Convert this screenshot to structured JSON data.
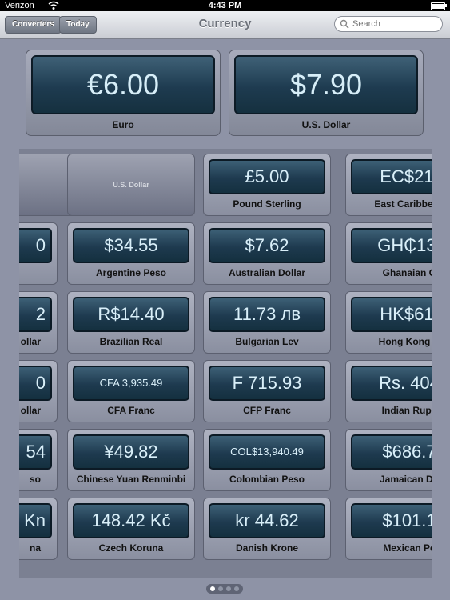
{
  "status": {
    "carrier": "Verizon",
    "time": "4:43 PM"
  },
  "nav": {
    "left_button": "Converters",
    "today_button": "Today",
    "title": "Currency",
    "search_placeholder": "Search"
  },
  "base": [
    {
      "value": "€6.00",
      "name": "Euro"
    },
    {
      "value": "$7.90",
      "name": "U.S. Dollar"
    }
  ],
  "grid": {
    "ghost_label": "U.S. Dollar",
    "tiles": [
      {
        "value": "£5.00",
        "name": "Pound Sterling"
      },
      {
        "value": "EC$21.",
        "name": "East Caribbean"
      },
      {
        "value": "0",
        "name": ""
      },
      {
        "value": "$34.55",
        "name": "Argentine Peso"
      },
      {
        "value": "$7.62",
        "name": "Australian Dollar"
      },
      {
        "value": "GH₵13.",
        "name": "Ghanaian C"
      },
      {
        "value": "2",
        "name": "ollar"
      },
      {
        "value": "R$14.40",
        "name": "Brazilian Real"
      },
      {
        "value": "11.73 лв",
        "name": "Bulgarian Lev"
      },
      {
        "value": "HK$61.",
        "name": "Hong Kong D"
      },
      {
        "value": "0",
        "name": "ollar"
      },
      {
        "value": "CFA 3,935.49",
        "name": "CFA Franc"
      },
      {
        "value": "F 715.93",
        "name": "CFP Franc"
      },
      {
        "value": "Rs. 404",
        "name": "Indian Rupe"
      },
      {
        "value": "54",
        "name": "so"
      },
      {
        "value": "¥49.82",
        "name": "Chinese Yuan Renminbi"
      },
      {
        "value": "COL$13,940.49",
        "name": "Colombian Peso"
      },
      {
        "value": "$686.7",
        "name": "Jamaican Do"
      },
      {
        "value": "Kn",
        "name": "na"
      },
      {
        "value": "148.42 Kč",
        "name": "Czech Koruna"
      },
      {
        "value": "kr 44.62",
        "name": "Danish Krone"
      },
      {
        "value": "$101.1",
        "name": "Mexican Pe"
      }
    ]
  },
  "pager": {
    "pages": 4,
    "current": 0
  }
}
